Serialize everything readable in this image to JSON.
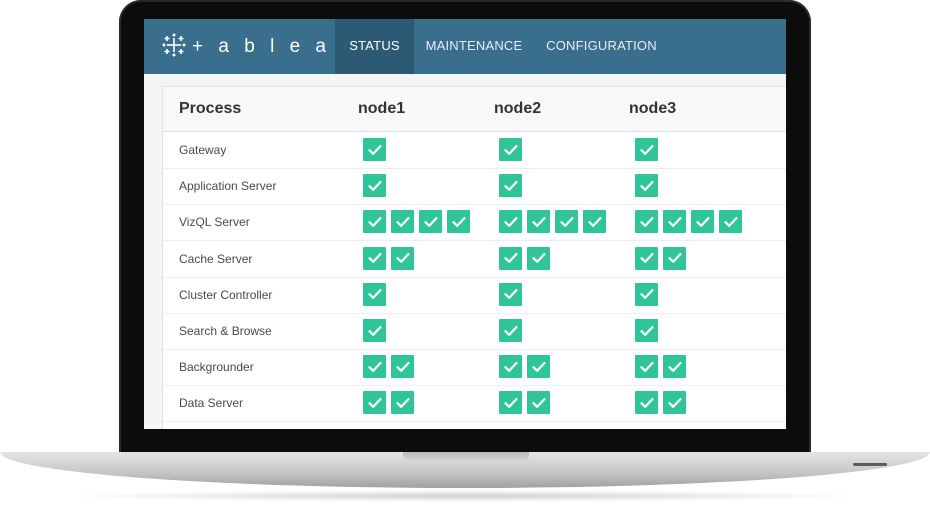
{
  "app": {
    "brand_name": "+ a b l e a u"
  },
  "nav": {
    "tabs": [
      {
        "label": "STATUS",
        "active": true
      },
      {
        "label": "MAINTENANCE",
        "active": false
      },
      {
        "label": "CONFIGURATION",
        "active": false
      }
    ]
  },
  "table": {
    "columns": [
      "Process",
      "node1",
      "node2",
      "node3"
    ],
    "status_color": "#2fc596",
    "rows": [
      {
        "process": "Gateway",
        "instances": [
          1,
          1,
          1
        ]
      },
      {
        "process": "Application Server",
        "instances": [
          1,
          1,
          1
        ]
      },
      {
        "process": "VizQL Server",
        "instances": [
          4,
          4,
          4
        ]
      },
      {
        "process": "Cache Server",
        "instances": [
          2,
          2,
          2
        ]
      },
      {
        "process": "Cluster Controller",
        "instances": [
          1,
          1,
          1
        ]
      },
      {
        "process": "Search & Browse",
        "instances": [
          1,
          1,
          1
        ]
      },
      {
        "process": "Backgrounder",
        "instances": [
          2,
          2,
          2
        ]
      },
      {
        "process": "Data Server",
        "instances": [
          2,
          2,
          2
        ]
      }
    ]
  }
}
